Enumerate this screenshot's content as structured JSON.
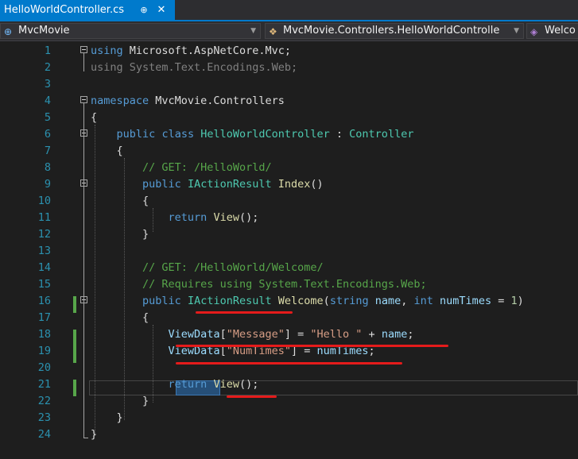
{
  "tab": {
    "title": "HelloWorldController.cs",
    "pin": "⊕",
    "close": "✕"
  },
  "nav": {
    "project": "MvcMovie",
    "type": "MvcMovie.Controllers.HelloWorldControlle",
    "member": "Welco"
  },
  "lines": [
    {
      "no": "1",
      "tokens": [
        [
          "kw",
          "using"
        ],
        [
          "bl",
          " Microsoft.AspNetCore.Mvc;"
        ]
      ]
    },
    {
      "no": "2",
      "tokens": [
        [
          "dim",
          "using System.Text.Encodings.Web;"
        ]
      ]
    },
    {
      "no": "3",
      "tokens": []
    },
    {
      "no": "4",
      "tokens": [
        [
          "kw",
          "namespace"
        ],
        [
          "bl",
          " MvcMovie.Controllers"
        ]
      ]
    },
    {
      "no": "5",
      "tokens": [
        [
          "bl",
          "{"
        ]
      ]
    },
    {
      "no": "6",
      "tokens": [
        [
          "bl",
          "    "
        ],
        [
          "kw",
          "public"
        ],
        [
          "bl",
          " "
        ],
        [
          "kw",
          "class"
        ],
        [
          "bl",
          " "
        ],
        [
          "ty",
          "HelloWorldController"
        ],
        [
          "bl",
          " : "
        ],
        [
          "ty",
          "Controller"
        ]
      ]
    },
    {
      "no": "7",
      "tokens": [
        [
          "bl",
          "    {"
        ]
      ]
    },
    {
      "no": "8",
      "tokens": [
        [
          "bl",
          "        "
        ],
        [
          "cm",
          "// GET: /HelloWorld/"
        ]
      ]
    },
    {
      "no": "9",
      "tokens": [
        [
          "bl",
          "        "
        ],
        [
          "kw",
          "public"
        ],
        [
          "bl",
          " "
        ],
        [
          "ty",
          "IActionResult"
        ],
        [
          "bl",
          " "
        ],
        [
          "fn",
          "Index"
        ],
        [
          "bl",
          "()"
        ]
      ]
    },
    {
      "no": "10",
      "tokens": [
        [
          "bl",
          "        {"
        ]
      ]
    },
    {
      "no": "11",
      "tokens": [
        [
          "bl",
          "            "
        ],
        [
          "kw",
          "return"
        ],
        [
          "bl",
          " "
        ],
        [
          "fn",
          "View"
        ],
        [
          "bl",
          "();"
        ]
      ]
    },
    {
      "no": "12",
      "tokens": [
        [
          "bl",
          "        }"
        ]
      ]
    },
    {
      "no": "13",
      "tokens": []
    },
    {
      "no": "14",
      "tokens": [
        [
          "bl",
          "        "
        ],
        [
          "cm",
          "// GET: /HelloWorld/Welcome/"
        ]
      ]
    },
    {
      "no": "15",
      "tokens": [
        [
          "bl",
          "        "
        ],
        [
          "cm",
          "// Requires using System.Text.Encodings.Web;"
        ]
      ]
    },
    {
      "no": "16",
      "tokens": [
        [
          "bl",
          "        "
        ],
        [
          "kw",
          "public"
        ],
        [
          "bl",
          " "
        ],
        [
          "ty",
          "IActionResult"
        ],
        [
          "bl",
          " "
        ],
        [
          "fn",
          "Welcome"
        ],
        [
          "bl",
          "("
        ],
        [
          "kw",
          "string"
        ],
        [
          "bl",
          " "
        ],
        [
          "pm",
          "name"
        ],
        [
          "bl",
          ", "
        ],
        [
          "kw",
          "int"
        ],
        [
          "bl",
          " "
        ],
        [
          "pm",
          "numTimes"
        ],
        [
          "bl",
          " = "
        ],
        [
          "nm",
          "1"
        ],
        [
          "bl",
          ")"
        ]
      ]
    },
    {
      "no": "17",
      "tokens": [
        [
          "bl",
          "        {"
        ]
      ]
    },
    {
      "no": "18",
      "tokens": [
        [
          "bl",
          "            "
        ],
        [
          "pm",
          "ViewData"
        ],
        [
          "bl",
          "["
        ],
        [
          "st",
          "\"Message\""
        ],
        [
          "bl",
          "] = "
        ],
        [
          "st",
          "\"Hello \""
        ],
        [
          "bl",
          " + "
        ],
        [
          "pm",
          "name"
        ],
        [
          "bl",
          ";"
        ]
      ]
    },
    {
      "no": "19",
      "tokens": [
        [
          "bl",
          "            "
        ],
        [
          "pm",
          "ViewData"
        ],
        [
          "bl",
          "["
        ],
        [
          "st",
          "\"NumTimes\""
        ],
        [
          "bl",
          "] = "
        ],
        [
          "pm",
          "numTimes"
        ],
        [
          "bl",
          ";"
        ]
      ]
    },
    {
      "no": "20",
      "tokens": []
    },
    {
      "no": "21",
      "tokens": [
        [
          "bl",
          "            "
        ],
        [
          "kw",
          "return"
        ],
        [
          "bl",
          " "
        ],
        [
          "fn",
          "View"
        ],
        [
          "bl",
          "();"
        ]
      ]
    },
    {
      "no": "22",
      "tokens": [
        [
          "bl",
          "        }"
        ]
      ]
    },
    {
      "no": "23",
      "tokens": [
        [
          "bl",
          "    }"
        ]
      ]
    },
    {
      "no": "24",
      "tokens": [
        [
          "bl",
          "}"
        ]
      ]
    }
  ]
}
